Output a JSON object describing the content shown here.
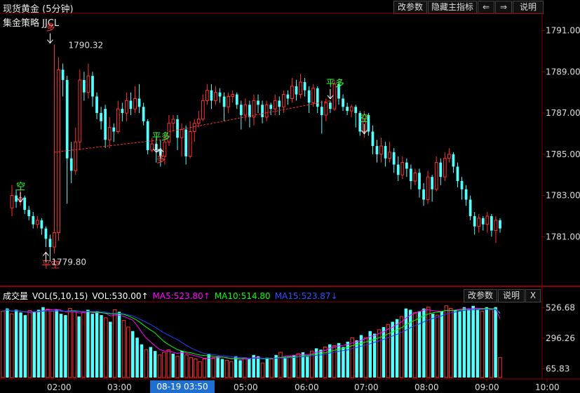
{
  "header": {
    "title": "现货黄金 (5分钟)",
    "strategy": "集金策略 JJCL",
    "buttons": [
      "改参数",
      "隐藏主指标",
      "⇐",
      "⇒",
      "说明"
    ]
  },
  "volume_panel": {
    "label": "成交量",
    "indicator": "VOL(5,10,15)",
    "vol": "VOL:530.00↑",
    "ma5": "MA5:523.80↑",
    "ma10": "MA10:514.80",
    "ma15": "MA15:523.87↓",
    "buttons": [
      "改参数",
      "说明",
      "X"
    ]
  },
  "cursor_time": "08-19 03:50",
  "colors": {
    "up": "#ff3232",
    "down": "#54ffff",
    "ma5": "#ff00ff",
    "ma10": "#00ff00",
    "ma15": "#2040ff",
    "signal_green": "#32ff32",
    "signal_red": "#ff3232"
  },
  "chart_data": [
    {
      "type": "candlestick",
      "title": "现货黄金 (5分钟)",
      "y_ticks": [
        "1791.00",
        "1789.00",
        "1787.00",
        "1785.00",
        "1783.00",
        "1781.00"
      ],
      "ylim": [
        1778.8,
        1791.8
      ],
      "x_ticks": [
        "02:00",
        "03:00",
        "04:00",
        "05:00",
        "06:00",
        "07:00",
        "08:00",
        "09:00",
        "10:00"
      ],
      "annotations": [
        {
          "text": "空",
          "price": 1783.3,
          "color": "green",
          "candle": 2
        },
        {
          "text": "多",
          "price": 1791.0,
          "color": "red",
          "candle": 9
        },
        {
          "text": "1790.32",
          "price": 1790.32
        },
        {
          "text": "平空",
          "price": 1779.5,
          "color": "red",
          "candle": 8
        },
        {
          "text": "1779.80",
          "price": 1779.8
        },
        {
          "text": "平多",
          "price": 1785.7,
          "color": "green",
          "candle": 34
        },
        {
          "text": "多",
          "price": 1784.6,
          "color": "red",
          "candle": 35
        },
        {
          "text": "平多",
          "price": 1788.3,
          "color": "green",
          "candle": 75
        },
        {
          "text": "空",
          "price": 1786.6,
          "color": "green",
          "candle": 83
        }
      ],
      "candles": [
        [
          1782.4,
          1783.0,
          1783.5,
          1782.0
        ],
        [
          1783.0,
          1782.7,
          1783.3,
          1782.4
        ],
        [
          1782.7,
          1782.9,
          1783.3,
          1782.5
        ],
        [
          1782.9,
          1782.3,
          1783.0,
          1782.1
        ],
        [
          1782.3,
          1782.0,
          1782.5,
          1781.8
        ],
        [
          1782.0,
          1781.6,
          1782.2,
          1781.4
        ],
        [
          1781.6,
          1781.8,
          1782.0,
          1781.4
        ],
        [
          1781.8,
          1781.4,
          1781.9,
          1781.1
        ],
        [
          1781.4,
          1780.9,
          1781.5,
          1780.5
        ],
        [
          1780.9,
          1780.5,
          1781.1,
          1779.8
        ],
        [
          1780.5,
          1781.2,
          1790.32,
          1780.2
        ],
        [
          1781.2,
          1789.1,
          1789.7,
          1780.8
        ],
        [
          1789.1,
          1788.6,
          1789.4,
          1787.8
        ],
        [
          1788.6,
          1784.8,
          1788.8,
          1782.6
        ],
        [
          1784.8,
          1784.2,
          1785.6,
          1783.6
        ],
        [
          1784.2,
          1785.6,
          1786.3,
          1784.0
        ],
        [
          1785.6,
          1788.6,
          1789.1,
          1785.2
        ],
        [
          1788.6,
          1788.0,
          1789.0,
          1787.6
        ],
        [
          1788.0,
          1788.8,
          1789.4,
          1787.7
        ],
        [
          1788.8,
          1787.8,
          1789.0,
          1787.3
        ],
        [
          1787.8,
          1787.0,
          1788.0,
          1786.7
        ],
        [
          1787.0,
          1786.6,
          1787.3,
          1786.2
        ],
        [
          1787.2,
          1785.7,
          1787.4,
          1785.3
        ],
        [
          1785.7,
          1786.3,
          1786.8,
          1785.3
        ],
        [
          1786.3,
          1786.1,
          1786.5,
          1785.6
        ],
        [
          1786.1,
          1787.2,
          1787.6,
          1786.0
        ],
        [
          1787.2,
          1787.0,
          1787.5,
          1786.6
        ],
        [
          1787.0,
          1787.6,
          1788.0,
          1786.6
        ],
        [
          1787.6,
          1787.2,
          1788.0,
          1786.9
        ],
        [
          1787.2,
          1787.7,
          1788.3,
          1787.0
        ],
        [
          1787.7,
          1787.3,
          1788.4,
          1787.0
        ],
        [
          1787.3,
          1786.6,
          1787.5,
          1786.4
        ],
        [
          1786.6,
          1785.2,
          1786.7,
          1785.0
        ],
        [
          1785.2,
          1785.5,
          1785.8,
          1785.1
        ],
        [
          1785.5,
          1785.2,
          1785.8,
          1784.6
        ],
        [
          1785.2,
          1784.9,
          1785.7,
          1784.4
        ],
        [
          1784.9,
          1785.6,
          1785.9,
          1784.5
        ],
        [
          1785.6,
          1786.5,
          1786.9,
          1785.4
        ],
        [
          1786.5,
          1786.7,
          1786.9,
          1786.1
        ],
        [
          1786.7,
          1785.8,
          1786.9,
          1785.2
        ],
        [
          1785.8,
          1786.2,
          1786.5,
          1784.9
        ],
        [
          1786.2,
          1784.9,
          1786.4,
          1784.5
        ],
        [
          1784.9,
          1786.1,
          1786.6,
          1784.8
        ],
        [
          1786.1,
          1786.5,
          1786.7,
          1785.6
        ],
        [
          1786.5,
          1786.7,
          1787.1,
          1786.3
        ],
        [
          1786.7,
          1787.6,
          1787.9,
          1786.6
        ],
        [
          1787.6,
          1788.1,
          1788.4,
          1787.4
        ],
        [
          1788.1,
          1787.6,
          1788.4,
          1787.2
        ],
        [
          1787.6,
          1788.0,
          1788.3,
          1787.4
        ],
        [
          1788.0,
          1787.8,
          1788.2,
          1787.5
        ],
        [
          1787.8,
          1787.3,
          1788.0,
          1786.6
        ],
        [
          1787.3,
          1787.8,
          1788.0,
          1787.0
        ],
        [
          1787.8,
          1787.9,
          1788.1,
          1787.5
        ],
        [
          1787.9,
          1787.4,
          1788.0,
          1787.2
        ],
        [
          1787.4,
          1786.9,
          1787.6,
          1786.2
        ],
        [
          1786.9,
          1787.4,
          1787.7,
          1786.6
        ],
        [
          1787.4,
          1786.8,
          1787.6,
          1786.3
        ],
        [
          1786.8,
          1787.6,
          1787.9,
          1786.4
        ],
        [
          1787.6,
          1787.4,
          1787.9,
          1787.0
        ],
        [
          1787.4,
          1786.8,
          1787.6,
          1786.5
        ],
        [
          1786.8,
          1787.4,
          1787.6,
          1786.6
        ],
        [
          1787.4,
          1787.2,
          1787.5,
          1786.9
        ],
        [
          1787.2,
          1787.6,
          1787.9,
          1786.9
        ],
        [
          1787.6,
          1787.3,
          1787.8,
          1786.9
        ],
        [
          1787.3,
          1787.9,
          1788.1,
          1787.0
        ],
        [
          1787.9,
          1787.7,
          1788.1,
          1787.4
        ],
        [
          1787.7,
          1788.3,
          1788.7,
          1787.5
        ],
        [
          1788.3,
          1787.9,
          1788.6,
          1787.6
        ],
        [
          1787.9,
          1788.5,
          1788.9,
          1787.7
        ],
        [
          1788.5,
          1788.1,
          1788.7,
          1787.8
        ],
        [
          1788.1,
          1787.5,
          1788.3,
          1787.0
        ],
        [
          1787.5,
          1788.2,
          1788.4,
          1787.3
        ],
        [
          1788.2,
          1787.3,
          1788.3,
          1787.0
        ],
        [
          1787.3,
          1786.9,
          1787.6,
          1786.0
        ],
        [
          1786.9,
          1787.5,
          1787.7,
          1786.6
        ],
        [
          1787.5,
          1787.2,
          1787.6,
          1787.0
        ],
        [
          1787.2,
          1788.4,
          1788.6,
          1787.1
        ],
        [
          1788.4,
          1787.7,
          1788.5,
          1787.4
        ],
        [
          1787.7,
          1787.3,
          1787.9,
          1787.1
        ],
        [
          1787.3,
          1787.1,
          1787.5,
          1786.9
        ],
        [
          1787.1,
          1787.3,
          1787.4,
          1786.8
        ],
        [
          1787.3,
          1787.0,
          1787.4,
          1786.3
        ],
        [
          1787.0,
          1786.1,
          1787.1,
          1785.9
        ],
        [
          1786.1,
          1786.9,
          1787.1,
          1785.8
        ],
        [
          1786.9,
          1786.1,
          1787.0,
          1785.9
        ],
        [
          1786.1,
          1785.4,
          1786.4,
          1785.0
        ],
        [
          1785.4,
          1785.0,
          1785.7,
          1784.6
        ],
        [
          1785.0,
          1785.4,
          1785.8,
          1784.6
        ],
        [
          1785.4,
          1784.8,
          1785.6,
          1784.4
        ],
        [
          1784.8,
          1785.1,
          1785.6,
          1784.6
        ],
        [
          1785.1,
          1784.5,
          1785.3,
          1784.1
        ],
        [
          1784.5,
          1784.0,
          1784.9,
          1783.7
        ],
        [
          1784.0,
          1784.6,
          1784.9,
          1783.8
        ],
        [
          1784.6,
          1784.3,
          1784.8,
          1783.9
        ],
        [
          1784.3,
          1783.7,
          1784.5,
          1783.3
        ],
        [
          1783.7,
          1784.1,
          1784.3,
          1783.5
        ],
        [
          1784.1,
          1783.3,
          1784.3,
          1782.9
        ],
        [
          1783.3,
          1782.8,
          1783.6,
          1782.5
        ],
        [
          1782.8,
          1783.9,
          1784.2,
          1782.6
        ],
        [
          1783.9,
          1783.3,
          1784.0,
          1782.7
        ],
        [
          1783.3,
          1784.6,
          1784.9,
          1783.2
        ],
        [
          1784.6,
          1783.9,
          1784.8,
          1783.5
        ],
        [
          1783.9,
          1784.8,
          1785.1,
          1783.7
        ],
        [
          1784.8,
          1785.0,
          1785.3,
          1784.6
        ],
        [
          1785.0,
          1784.4,
          1785.1,
          1784.1
        ],
        [
          1784.4,
          1783.7,
          1784.6,
          1783.4
        ],
        [
          1783.7,
          1783.3,
          1783.9,
          1782.8
        ],
        [
          1783.3,
          1782.8,
          1783.5,
          1782.5
        ],
        [
          1782.8,
          1782.0,
          1783.0,
          1781.8
        ],
        [
          1782.0,
          1781.5,
          1782.2,
          1781.1
        ],
        [
          1781.5,
          1781.9,
          1782.1,
          1781.2
        ],
        [
          1781.9,
          1781.6,
          1782.0,
          1781.3
        ],
        [
          1781.6,
          1782.0,
          1782.2,
          1781.2
        ],
        [
          1782.0,
          1781.3,
          1782.1,
          1781.0
        ],
        [
          1781.3,
          1781.8,
          1782.0,
          1780.7
        ],
        [
          1781.8,
          1781.4,
          1781.9,
          1781.2
        ]
      ],
      "lines": [
        {
          "name": "long-trend",
          "color": "red",
          "points": [
            [
              10,
              1785.1
            ],
            [
              35,
              1785.7
            ]
          ]
        },
        {
          "name": "mid-trend",
          "color": "red",
          "points": [
            [
              37,
              1786.1
            ],
            [
              75,
              1787.6
            ]
          ]
        }
      ]
    },
    {
      "type": "bar",
      "title": "成交量 VOL(5,10,15)",
      "y_ticks": [
        "526.68",
        "296.26",
        "65.83"
      ],
      "ylim": [
        0,
        560
      ],
      "volumes": [
        500,
        520,
        480,
        510,
        490,
        470,
        505,
        495,
        510,
        530,
        515,
        500,
        510,
        480,
        470,
        520,
        500,
        460,
        490,
        510,
        480,
        500,
        470,
        450,
        420,
        510,
        495,
        430,
        380,
        350,
        300,
        250,
        210,
        230,
        200,
        170,
        190,
        210,
        180,
        160,
        200,
        170,
        150,
        140,
        120,
        140,
        180,
        150,
        160,
        140,
        130,
        120,
        160,
        130,
        150,
        140,
        170,
        160,
        110,
        150,
        140,
        170,
        190,
        150,
        160,
        170,
        180,
        190,
        160,
        200,
        220,
        210,
        230,
        250,
        240,
        260,
        230,
        270,
        300,
        280,
        320,
        300,
        350,
        330,
        360,
        380,
        400,
        420,
        440,
        460,
        520,
        510,
        490,
        500,
        520,
        530,
        480,
        470,
        500,
        540,
        520,
        510,
        500,
        530,
        520,
        540,
        515,
        500,
        530,
        510,
        530,
        150
      ],
      "series": [
        {
          "name": "MA5",
          "value": 523.8
        },
        {
          "name": "MA10",
          "value": 514.8
        },
        {
          "name": "MA15",
          "value": 523.87
        }
      ]
    }
  ]
}
